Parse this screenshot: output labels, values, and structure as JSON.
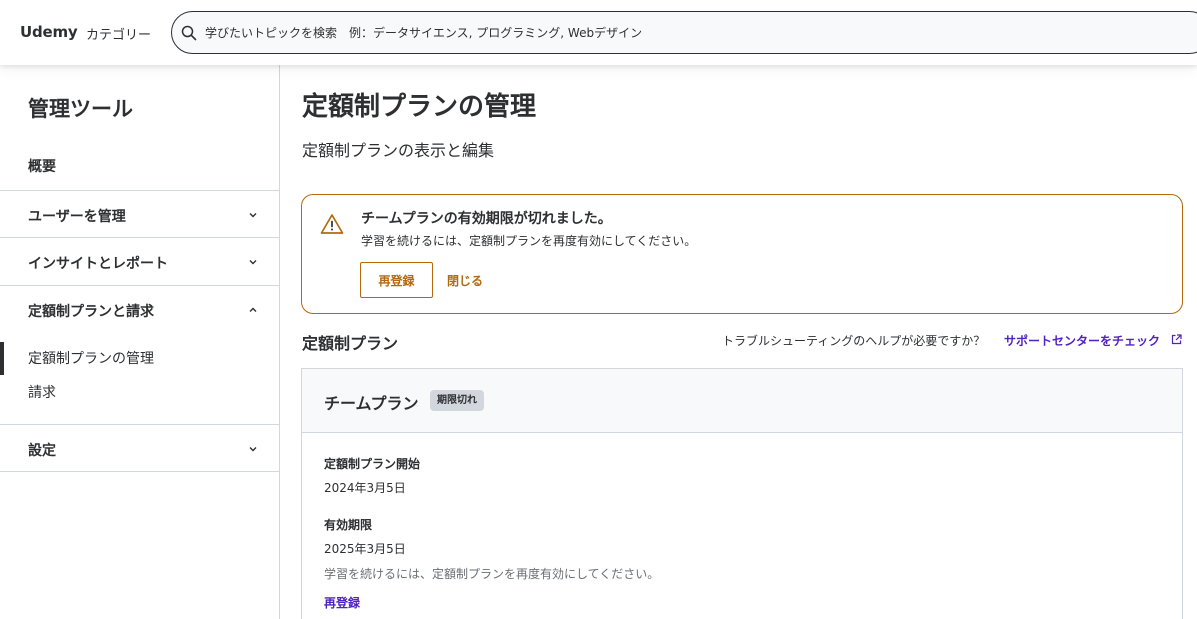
{
  "header": {
    "logo": "Udemy",
    "categories_label": "カテゴリー",
    "search_placeholder": "学びたいトピックを検索　例：データサイエンス, プログラミング, Webデザイン"
  },
  "sidebar": {
    "title": "管理ツール",
    "overview": "概要",
    "items": [
      {
        "label": "ユーザーを管理",
        "expanded": false
      },
      {
        "label": "インサイトとレポート",
        "expanded": false
      },
      {
        "label": "定額制プランと請求",
        "expanded": true
      },
      {
        "label": "設定",
        "expanded": false
      }
    ],
    "subitems": [
      {
        "label": "定額制プランの管理",
        "active": true
      },
      {
        "label": "請求",
        "active": false
      }
    ]
  },
  "main": {
    "title": "定額制プランの管理",
    "subtitle": "定額制プランの表示と編集",
    "alert": {
      "title": "チームプランの有効期限が切れました。",
      "message": "学習を続けるには、定額制プランを再度有効にしてください。",
      "primary_button": "再登録",
      "dismiss_button": "閉じる"
    },
    "plans_heading": "定額制プラン",
    "help_text": "トラブルシューティングのヘルプが必要ですか？",
    "support_link": "サポートセンターをチェック",
    "plan_card": {
      "name": "チームプラン",
      "status_badge": "期限切れ",
      "start_label": "定額制プラン開始",
      "start_date": "2024年3月5日",
      "expiry_label": "有効期限",
      "expiry_date": "2025年3月5日",
      "note": "学習を続けるには、定額制プランを再度有効にしてください。",
      "reenroll_link": "再登録"
    }
  },
  "colors": {
    "warning": "#b4690e",
    "link": "#5022c3",
    "text": "#2d2f31",
    "border": "#d1d7dc"
  }
}
